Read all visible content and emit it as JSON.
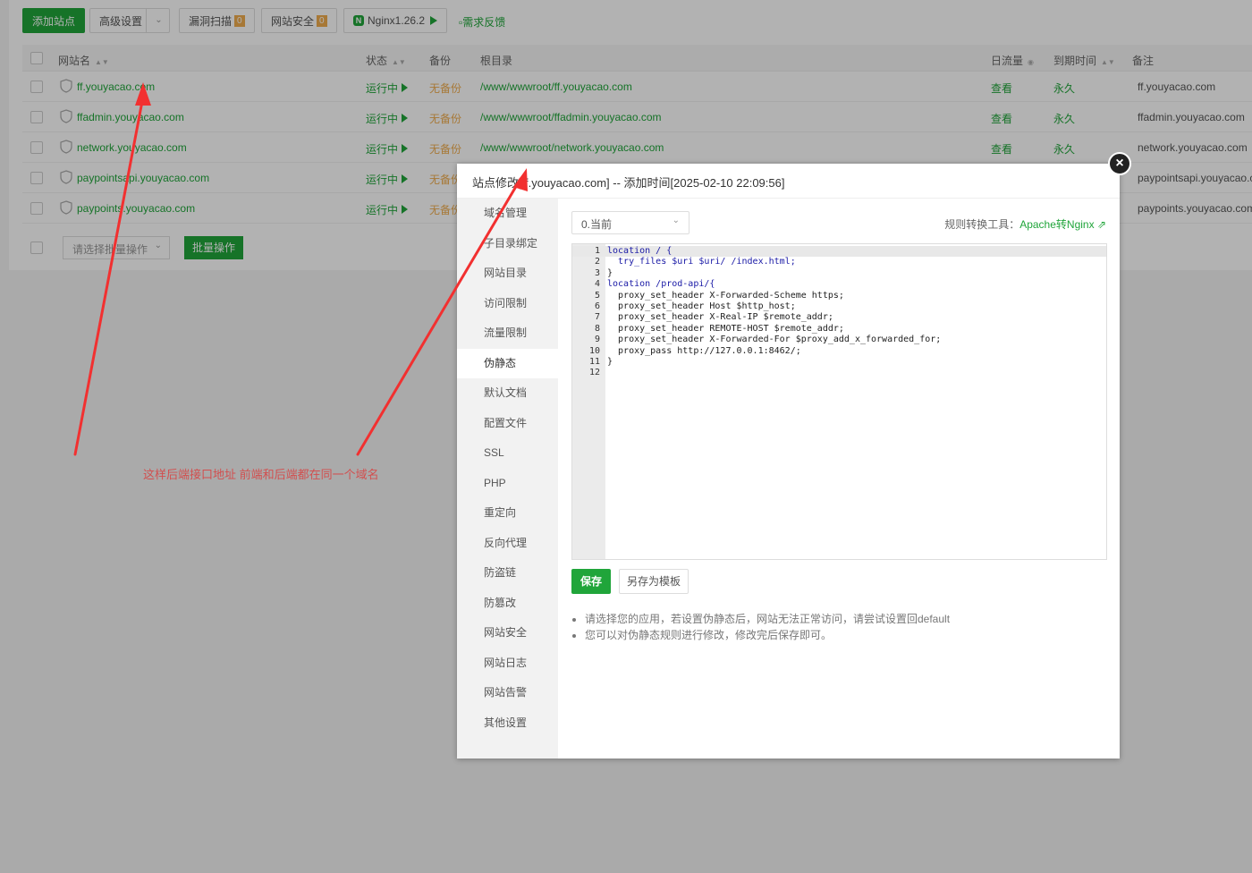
{
  "toolbar": {
    "add_site": "添加站点",
    "advanced": "高级设置",
    "vuln_scan": "漏洞扫描",
    "vuln_count": "0",
    "site_security": "网站安全",
    "security_count": "0",
    "nginx": "Nginx1.26.2",
    "feedback": "需求反馈"
  },
  "table": {
    "headers": {
      "name": "网站名",
      "status": "状态",
      "backup": "备份",
      "root": "根目录",
      "traffic": "日流量",
      "expire": "到期时间",
      "remark": "备注"
    },
    "rows": [
      {
        "name": "ff.youyacao.com",
        "status": "运行中",
        "backup": "无备份",
        "path": "/www/wwwroot/ff.youyacao.com",
        "traffic": "查看",
        "expire": "永久",
        "remark": "ff.youyacao.com"
      },
      {
        "name": "ffadmin.youyacao.com",
        "status": "运行中",
        "backup": "无备份",
        "path": "/www/wwwroot/ffadmin.youyacao.com",
        "traffic": "查看",
        "expire": "永久",
        "remark": "ffadmin.youyacao.com"
      },
      {
        "name": "network.youyacao.com",
        "status": "运行中",
        "backup": "无备份",
        "path": "/www/wwwroot/network.youyacao.com",
        "traffic": "查看",
        "expire": "永久",
        "remark": "network.youyacao.com"
      },
      {
        "name": "paypointsapi.youyacao.com",
        "status": "运行中",
        "backup": "无备份",
        "path": "",
        "traffic": "",
        "expire": "",
        "remark": "paypointsapi.youyacao.co"
      },
      {
        "name": "paypoints.youyacao.com",
        "status": "运行中",
        "backup": "无备份",
        "path": "",
        "traffic": "",
        "expire": "",
        "remark": "paypoints.youyacao.com"
      }
    ],
    "batch_placeholder": "请选择批量操作",
    "batch_button": "批量操作"
  },
  "modal": {
    "title": "站点修改[ff.youyacao.com] -- 添加时间[2025-02-10 22:09:56]",
    "sidebar": [
      "域名管理",
      "子目录绑定",
      "网站目录",
      "访问限制",
      "流量限制",
      "伪静态",
      "默认文档",
      "配置文件",
      "SSL",
      "PHP",
      "重定向",
      "反向代理",
      "防盗链",
      "防篡改",
      "网站安全",
      "网站日志",
      "网站告警",
      "其他设置"
    ],
    "version_select": "0.当前",
    "rule_tool_label": "规则转换工具：",
    "rule_tool_link": "Apache转Nginx",
    "code_lines": [
      "location / {",
      "  try_files $uri $uri/ /index.html;",
      "}",
      "location /prod-api/{",
      "  proxy_set_header X-Forwarded-Scheme https;",
      "  proxy_set_header Host $http_host;",
      "  proxy_set_header X-Real-IP $remote_addr;",
      "  proxy_set_header REMOTE-HOST $remote_addr;",
      "  proxy_set_header X-Forwarded-For $proxy_add_x_forwarded_for;",
      "  proxy_pass http://127.0.0.1:8462/;",
      "}",
      ""
    ],
    "save": "保存",
    "save_template": "另存为模板",
    "tips": [
      "请选择您的应用，若设置伪静态后，网站无法正常访问，请尝试设置回default",
      "您可以对伪静态规则进行修改，修改完后保存即可。"
    ]
  },
  "annotation": {
    "text": "这样后端接口地址 前端和后端都在同一个域名"
  },
  "colors": {
    "accent": "#20a53a",
    "warning": "#f0ad4e",
    "annotation": "#e03030"
  }
}
